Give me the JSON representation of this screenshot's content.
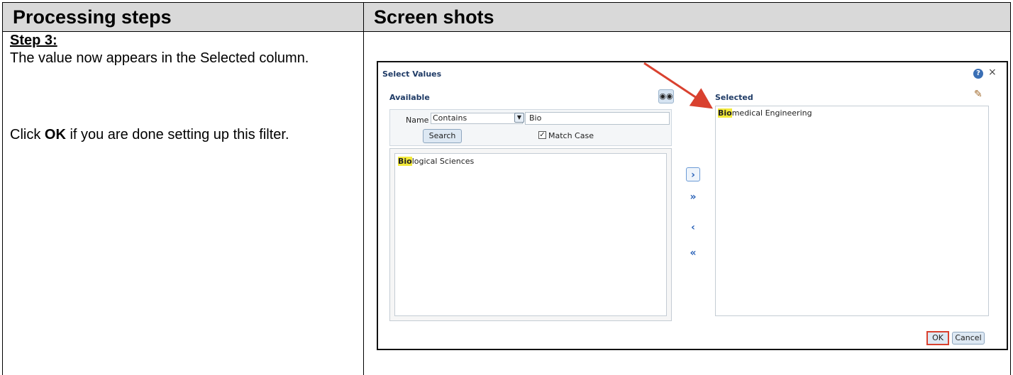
{
  "header": {
    "left": "Processing steps",
    "right": "Screen shots"
  },
  "instructions": {
    "step_title": "Step 3:",
    "line1": "The value now appears in the Selected column.",
    "line2_prefix": "Click ",
    "line2_bold": "OK",
    "line2_suffix": " if you are done setting up this filter."
  },
  "dialog": {
    "title": "Select Values",
    "available_label": "Available",
    "selected_label": "Selected",
    "search": {
      "name_label": "Name",
      "operator": "Contains",
      "value": "Bio",
      "button": "Search",
      "match_case_label": "Match Case",
      "match_case_checked": true
    },
    "available_items": [
      {
        "highlight": "Bio",
        "rest": "logical Sciences"
      }
    ],
    "selected_items": [
      {
        "highlight": "Bio",
        "rest": "medical Engineering"
      }
    ],
    "buttons": {
      "ok": "OK",
      "cancel": "Cancel"
    },
    "icons": [
      "help-icon",
      "close-icon",
      "binoculars-icon",
      "pencil-icon",
      "move-right-icon",
      "move-all-right-icon",
      "move-left-icon",
      "move-all-left-icon"
    ]
  },
  "colors": {
    "header_bg": "#d9d9d9",
    "highlight": "#f3ea3a",
    "callout": "#d9412f",
    "dialog_label": "#1f3b66"
  }
}
